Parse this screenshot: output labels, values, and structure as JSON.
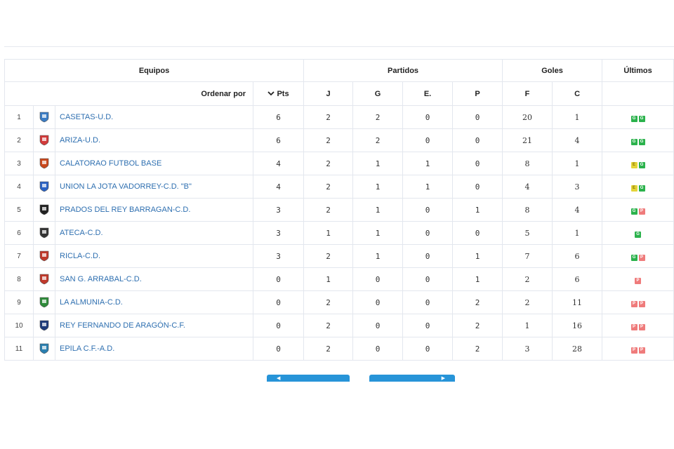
{
  "header": {
    "equipos": "Equipos",
    "partidos": "Partidos",
    "goles": "Goles",
    "ultimos": "Últimos",
    "ordenar_por": "Ordenar por",
    "pts": "Pts",
    "j": "J",
    "g": "G",
    "e": "E.",
    "p": "P",
    "f": "F",
    "c": "C"
  },
  "rows": [
    {
      "pos": "1",
      "name": "CASETAS-U.D.",
      "pts": "6",
      "j": "2",
      "g": "2",
      "e": "0",
      "p": "0",
      "f": "20",
      "c": "1",
      "last": [
        "G",
        "G"
      ],
      "crest": "casetas-crest-icon",
      "color": "#3b7cc4"
    },
    {
      "pos": "2",
      "name": "ARIZA-U.D.",
      "pts": "6",
      "j": "2",
      "g": "2",
      "e": "0",
      "p": "0",
      "f": "21",
      "c": "4",
      "last": [
        "G",
        "G"
      ],
      "crest": "ariza-crest-icon",
      "color": "#d23a3a"
    },
    {
      "pos": "3",
      "name": "CALATORAO FUTBOL BASE",
      "pts": "4",
      "j": "2",
      "g": "1",
      "e": "1",
      "p": "0",
      "f": "8",
      "c": "1",
      "last": [
        "E",
        "G"
      ],
      "crest": "calatorao-crest-icon",
      "color": "#c9471c"
    },
    {
      "pos": "4",
      "name": "UNION LA JOTA VADORREY-C.D. \"B\"",
      "pts": "4",
      "j": "2",
      "g": "1",
      "e": "1",
      "p": "0",
      "f": "4",
      "c": "3",
      "last": [
        "E",
        "G"
      ],
      "crest": "union-la-jota-crest-icon",
      "color": "#2a62c4"
    },
    {
      "pos": "5",
      "name": "PRADOS DEL REY BARRAGAN-C.D.",
      "pts": "3",
      "j": "2",
      "g": "1",
      "e": "0",
      "p": "1",
      "f": "8",
      "c": "4",
      "last": [
        "G",
        "P"
      ],
      "crest": "prados-crest-icon",
      "color": "#222222"
    },
    {
      "pos": "6",
      "name": "ATECA-C.D.",
      "pts": "3",
      "j": "1",
      "g": "1",
      "e": "0",
      "p": "0",
      "f": "5",
      "c": "1",
      "last": [
        "G"
      ],
      "crest": "ateca-crest-icon",
      "color": "#333333"
    },
    {
      "pos": "7",
      "name": "RICLA-C.D.",
      "pts": "3",
      "j": "2",
      "g": "1",
      "e": "0",
      "p": "1",
      "f": "7",
      "c": "6",
      "last": [
        "G",
        "P"
      ],
      "crest": "ricla-crest-icon",
      "color": "#c0392b"
    },
    {
      "pos": "8",
      "name": "SAN G. ARRABAL-C.D.",
      "pts": "0",
      "j": "1",
      "g": "0",
      "e": "0",
      "p": "1",
      "f": "2",
      "c": "6",
      "last": [
        "P"
      ],
      "crest": "san-g-arrabal-crest-icon",
      "color": "#c0392b"
    },
    {
      "pos": "9",
      "name": "LA ALMUNIA-C.D.",
      "pts": "0",
      "j": "2",
      "g": "0",
      "e": "0",
      "p": "2",
      "f": "2",
      "c": "11",
      "last": [
        "P",
        "P"
      ],
      "crest": "la-almunia-crest-icon",
      "color": "#2e8b3a"
    },
    {
      "pos": "10",
      "name": "REY FERNANDO DE ARAGÓN-C.F.",
      "pts": "0",
      "j": "2",
      "g": "0",
      "e": "0",
      "p": "2",
      "f": "1",
      "c": "16",
      "last": [
        "P",
        "P"
      ],
      "crest": "rey-fernando-crest-icon",
      "color": "#1d3a7a"
    },
    {
      "pos": "11",
      "name": "EPILA C.F.-A.D.",
      "pts": "0",
      "j": "2",
      "g": "0",
      "e": "0",
      "p": "2",
      "f": "3",
      "c": "28",
      "last": [
        "P",
        "P"
      ],
      "crest": "epila-crest-icon",
      "color": "#2a7fb0"
    }
  ],
  "nav": {
    "prev_icon": "chevron-left-icon",
    "next_icon": "chevron-right-icon",
    "accent": "#2794d8"
  }
}
